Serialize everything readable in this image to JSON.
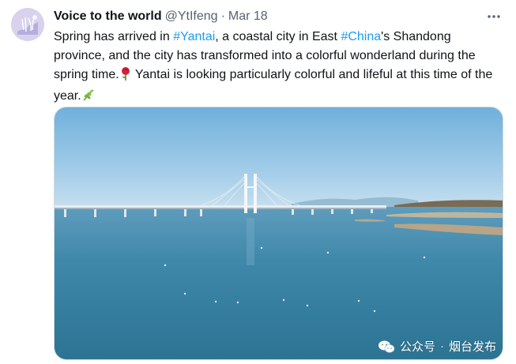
{
  "tweet": {
    "author": {
      "display_name": "Voice to the world",
      "handle": "@YtIfeng",
      "separator": "·",
      "date": "Mar 18",
      "avatar_icon": "avatar-image"
    },
    "more_icon": "more-options-icon",
    "text_parts": {
      "p1": "Spring has arrived in ",
      "hashtag1": "#Yantai",
      "p2": ", a coastal city in East ",
      "hashtag2": "#China",
      "p3": "'s Shandong province, and the city has transformed into a colorful wonderland during the spring time.",
      "emoji1": "rose-icon",
      "p4": " Yantai is looking particularly colorful and lifeful at this time of the year.",
      "emoji2": "herb-icon"
    },
    "colors": {
      "text": "#0f1419",
      "secondary": "#536471",
      "link": "#1d9bf0"
    },
    "media": {
      "description_icon": "bridge-photo",
      "watermark": {
        "icon": "wechat-icon",
        "account_type": "公众号",
        "separator": "·",
        "name": "烟台发布"
      }
    }
  }
}
